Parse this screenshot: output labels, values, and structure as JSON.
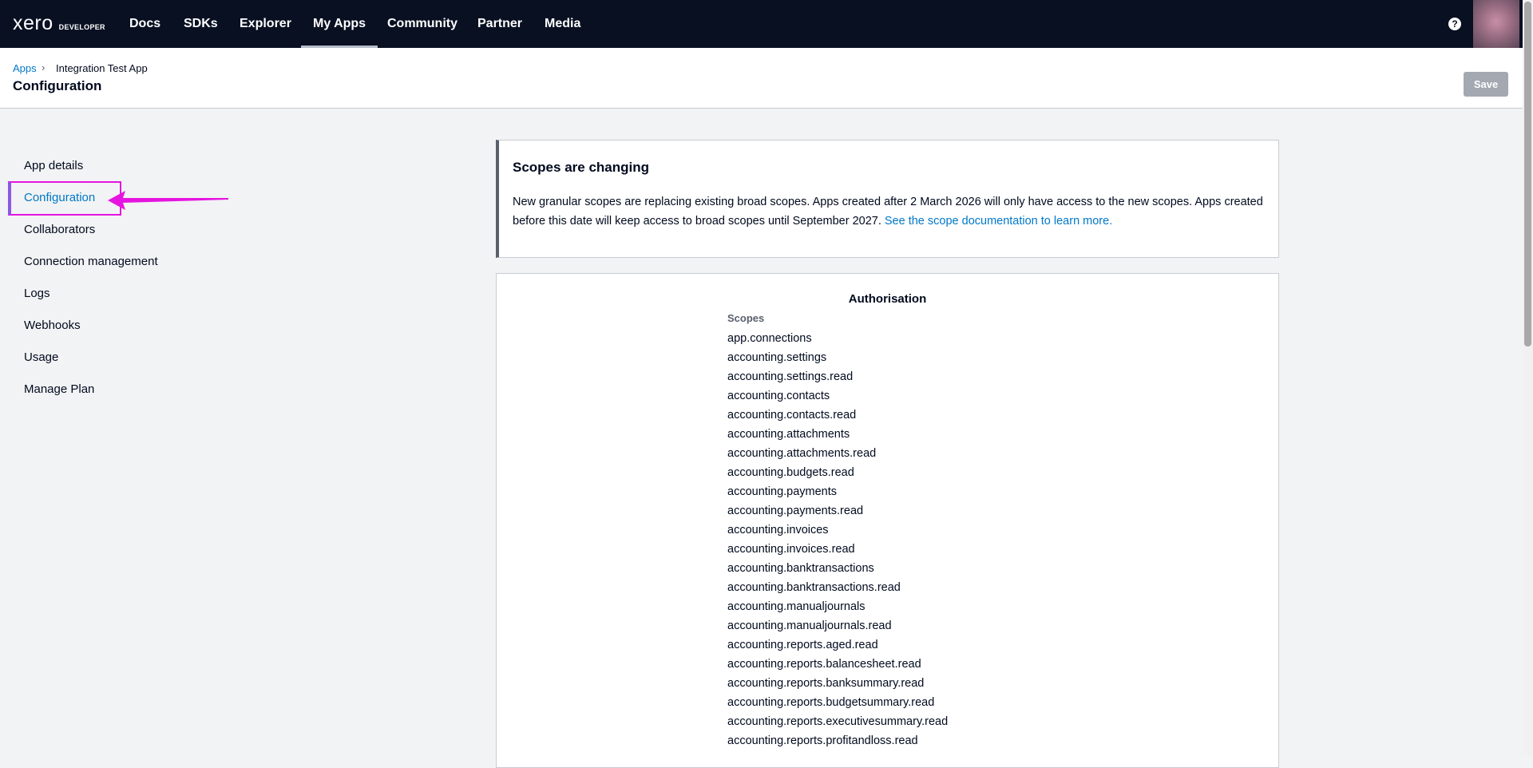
{
  "nav": {
    "logo": "xero",
    "logo_sub": "DEVELOPER",
    "items": [
      "Docs",
      "SDKs",
      "Explorer",
      "My Apps",
      "Community",
      "Partner",
      "Media"
    ],
    "active": "My Apps",
    "help_icon": "?"
  },
  "header": {
    "breadcrumb_link": "Apps",
    "breadcrumb_sep": "›",
    "breadcrumb_current": "Integration Test App",
    "title": "Configuration",
    "save_label": "Save"
  },
  "sidebar": {
    "items": [
      "App details",
      "Configuration",
      "Collaborators",
      "Connection management",
      "Logs",
      "Webhooks",
      "Usage",
      "Manage Plan"
    ],
    "active": "Configuration"
  },
  "notice": {
    "title": "Scopes are changing",
    "body": "New granular scopes are replacing existing broad scopes. Apps created after 2 March 2026 will only have access to the new scopes. Apps created before this date will keep access to broad scopes until September 2027.",
    "link": "See the scope documentation to learn more."
  },
  "auth": {
    "title": "Authorisation",
    "scopes_label": "Scopes",
    "scopes": [
      "app.connections",
      "accounting.settings",
      "accounting.settings.read",
      "accounting.contacts",
      "accounting.contacts.read",
      "accounting.attachments",
      "accounting.attachments.read",
      "accounting.budgets.read",
      "accounting.payments",
      "accounting.payments.read",
      "accounting.invoices",
      "accounting.invoices.read",
      "accounting.banktransactions",
      "accounting.banktransactions.read",
      "accounting.manualjournals",
      "accounting.manualjournals.read",
      "accounting.reports.aged.read",
      "accounting.reports.balancesheet.read",
      "accounting.reports.banksummary.read",
      "accounting.reports.budgetsummary.read",
      "accounting.reports.executivesummary.read",
      "accounting.reports.profitandloss.read"
    ]
  },
  "colors": {
    "nav_bg": "#091022",
    "link": "#0078c8",
    "annotation_pink": "#e514e0"
  }
}
